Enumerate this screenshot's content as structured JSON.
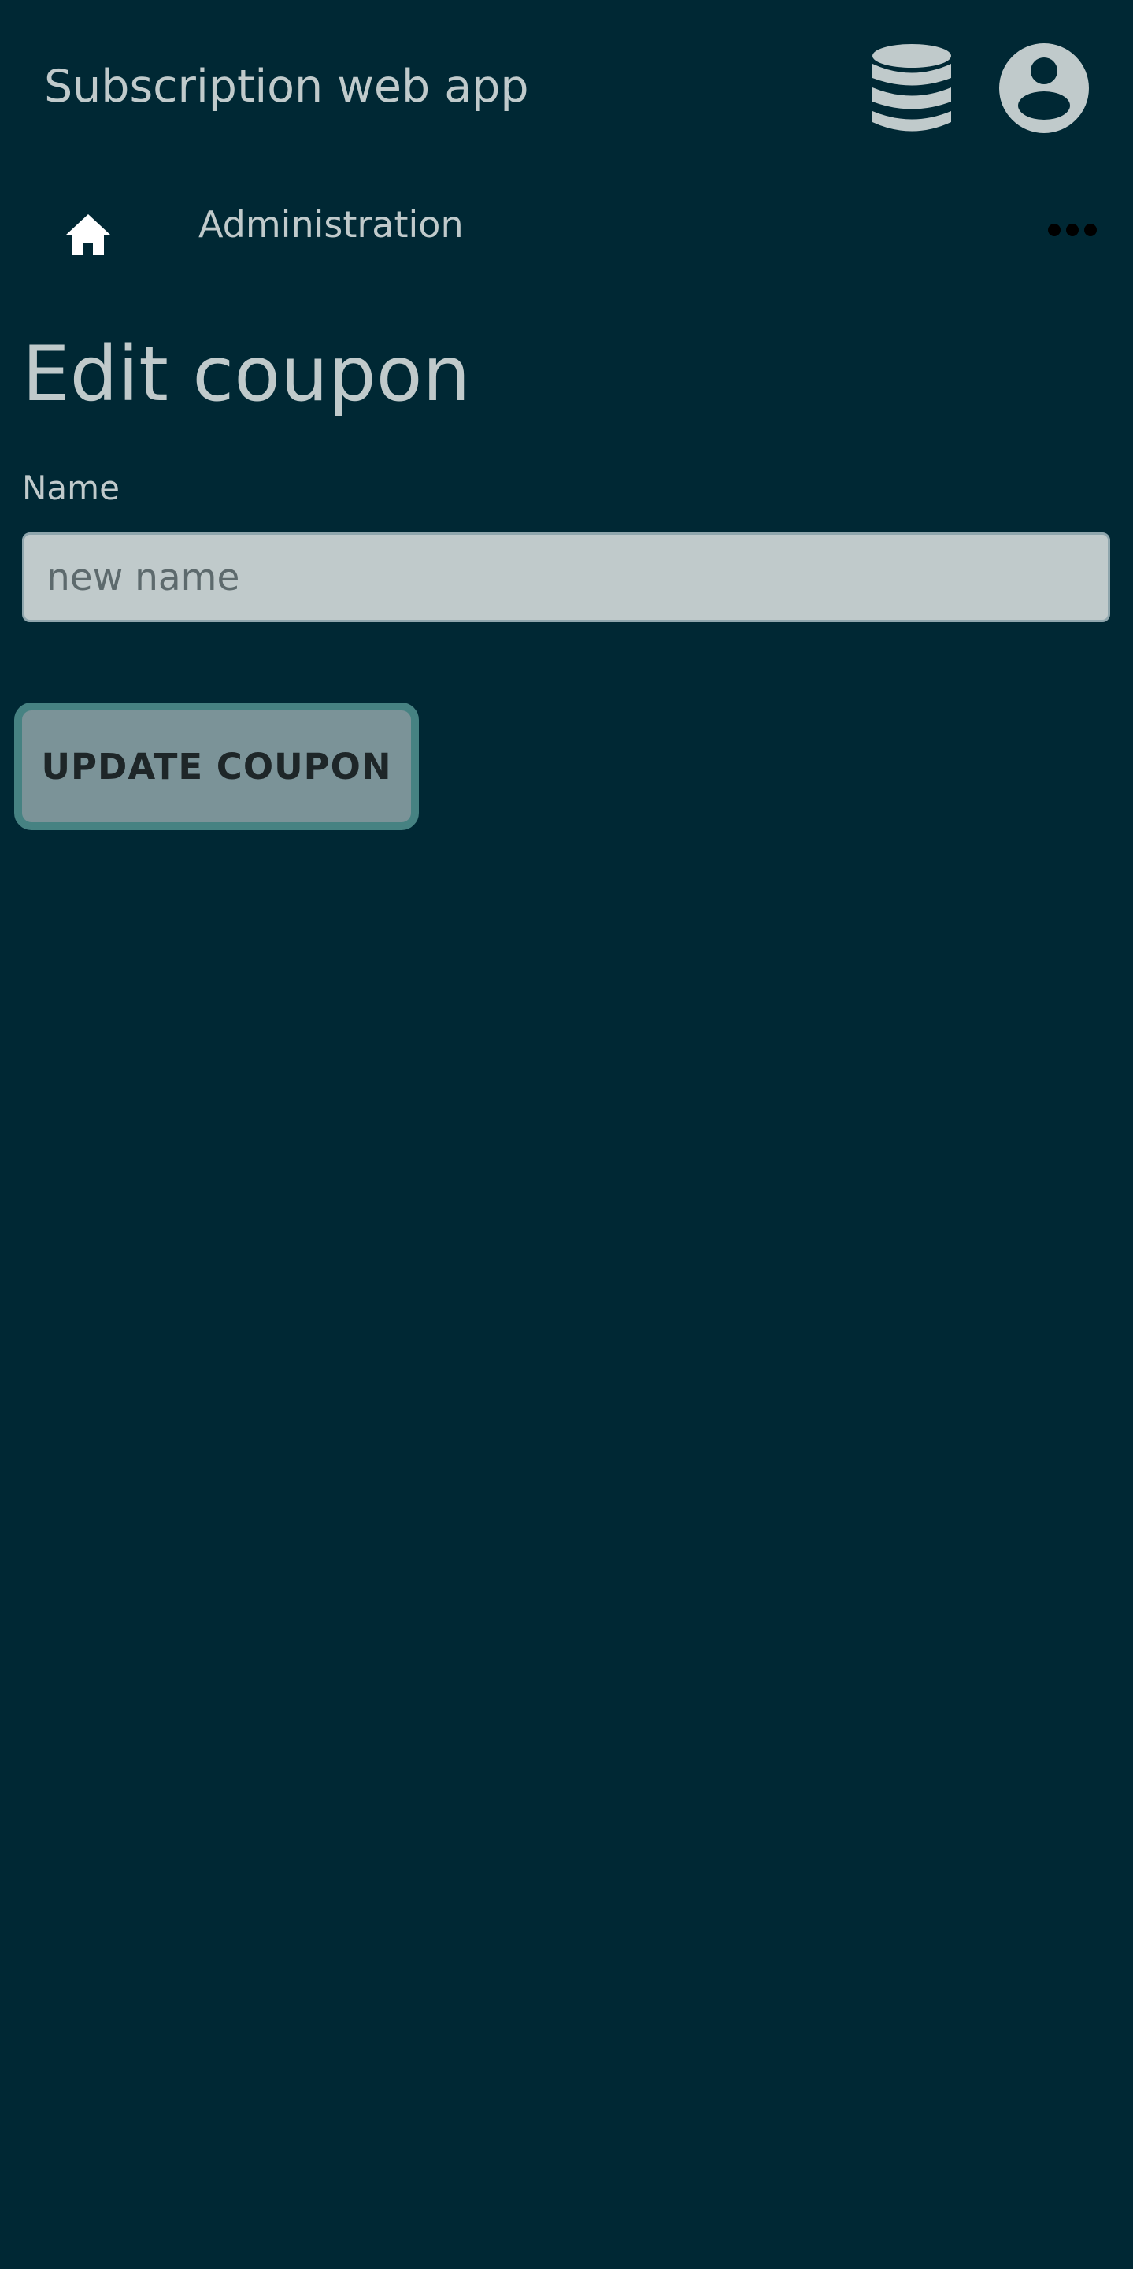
{
  "header": {
    "app_title": "Subscription web app",
    "database_icon": "database-icon",
    "account_icon": "account-circle-icon"
  },
  "nav": {
    "home_icon": "home-icon",
    "admin_label": "Administration",
    "more_icon": "more-horizontal-icon"
  },
  "page": {
    "title": "Edit coupon"
  },
  "form": {
    "name_label": "Name",
    "name_value": "",
    "name_placeholder": "new name",
    "submit_label": "UPDATE COUPON"
  },
  "colors": {
    "background": "#002834",
    "text": "#c0cacb",
    "input_background": "#c0cacb",
    "button_background": "#7b9398",
    "button_border": "#468282",
    "button_text": "#1e2628"
  }
}
